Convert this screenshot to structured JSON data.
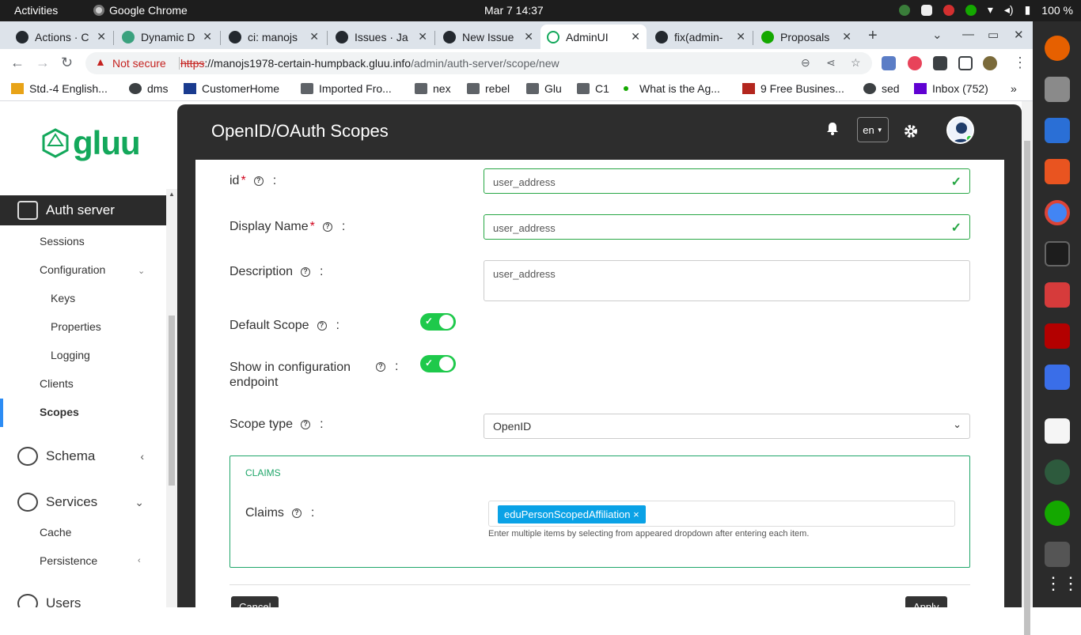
{
  "system": {
    "activities": "Activities",
    "app_name": "Google Chrome",
    "clock": "Mar 7  14:37",
    "battery": "100 %"
  },
  "browser": {
    "tabs": [
      {
        "title": "Actions · C",
        "icon": "github-icon"
      },
      {
        "title": "Dynamic D",
        "icon": "app-icon"
      },
      {
        "title": "ci: manojs",
        "icon": "github-icon"
      },
      {
        "title": "Issues · Ja",
        "icon": "github-icon"
      },
      {
        "title": "New Issue",
        "icon": "github-icon"
      },
      {
        "title": "AdminUI",
        "icon": "gluu-icon",
        "active": true
      },
      {
        "title": "fix(admin-",
        "icon": "github-icon"
      },
      {
        "title": "Proposals",
        "icon": "upwork-icon"
      }
    ],
    "not_secure": "Not secure",
    "url_scheme": "https",
    "url_host": "://manojs1978-certain-humpback.gluu.info",
    "url_path": "/admin/auth-server/scope/new",
    "bookmarks": [
      {
        "label": "Std.-4 English...",
        "icon": "bookmark-icon"
      },
      {
        "label": "dms",
        "icon": "globe-icon"
      },
      {
        "label": "CustomerHome",
        "icon": "site-icon"
      },
      {
        "label": "Imported Fro...",
        "icon": "folder-icon"
      },
      {
        "label": "nex",
        "icon": "folder-icon"
      },
      {
        "label": "rebel",
        "icon": "folder-icon"
      },
      {
        "label": "Glu",
        "icon": "folder-icon"
      },
      {
        "label": "C1",
        "icon": "folder-icon"
      },
      {
        "label": "What is the Ag...",
        "icon": "dot-icon"
      },
      {
        "label": "9 Free Busines...",
        "icon": "site-icon"
      },
      {
        "label": "sed",
        "icon": "globe-icon"
      },
      {
        "label": "Inbox (752)",
        "icon": "yahoo-icon"
      }
    ]
  },
  "sidebar": {
    "logo_text": "gluu",
    "auth_server": "Auth server",
    "items": {
      "sessions": "Sessions",
      "configuration": "Configuration",
      "keys": "Keys",
      "properties": "Properties",
      "logging": "Logging",
      "clients": "Clients",
      "scopes": "Scopes"
    },
    "schema": "Schema",
    "services": "Services",
    "cache": "Cache",
    "persistence": "Persistence",
    "users": "Users"
  },
  "header": {
    "title": "OpenID/OAuth Scopes",
    "language": "en"
  },
  "form": {
    "id_label": "id",
    "id_value": "user_address",
    "display_name_label": "Display Name",
    "display_name_value": "user_address",
    "description_label": "Description",
    "description_value": "user_address",
    "default_scope_label": "Default Scope",
    "default_scope_on": true,
    "show_config_label": "Show in configuration endpoint",
    "show_config_on": true,
    "scope_type_label": "Scope type",
    "scope_type_value": "OpenID",
    "colon": ":",
    "required_mark": "*",
    "claims_section_title": "CLAIMS",
    "claims_label": "Claims",
    "claims_chip": "eduPersonScopedAffiliation ×",
    "claims_help": "Enter multiple items by selecting from appeared dropdown after entering each item.",
    "cancel_label": "Cancel",
    "apply_label": "Apply"
  },
  "colors": {
    "accent_green": "#20a66a",
    "toggle_on": "#1ec94b",
    "chip_blue": "#0aa2e6",
    "dark_panel": "#2d2d2d"
  }
}
